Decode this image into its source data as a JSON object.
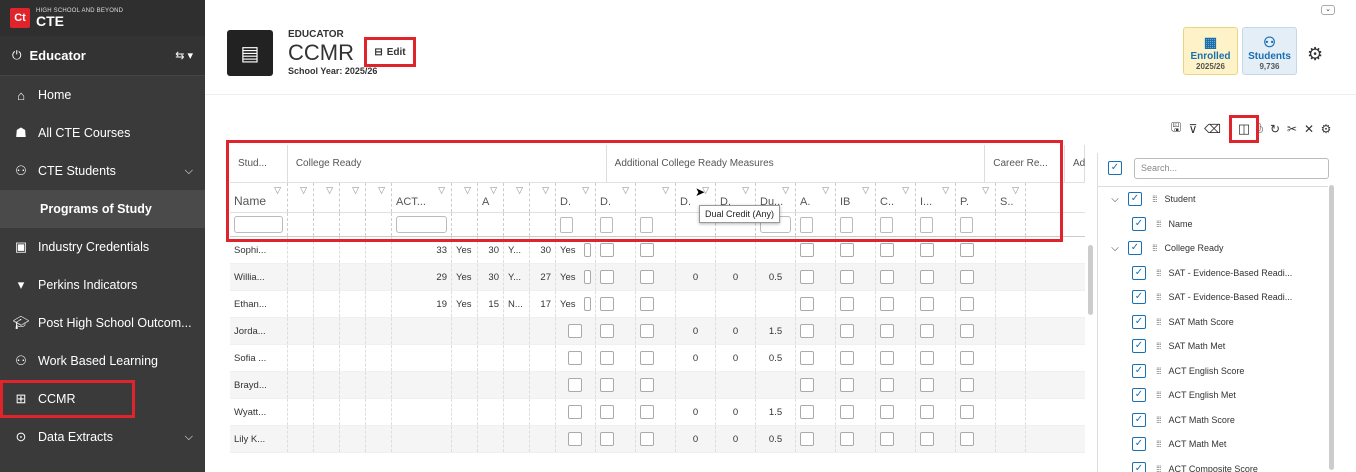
{
  "brand": {
    "small": "HIGH SCHOOL AND BEYOND",
    "name": "CTE",
    "logo": "Ct"
  },
  "role": {
    "label": "Educator"
  },
  "nav": [
    {
      "label": "Home",
      "icon": "home-icon"
    },
    {
      "label": "All CTE Courses",
      "icon": "courses-icon"
    },
    {
      "label": "CTE Students",
      "icon": "students-icon"
    },
    {
      "label": "Programs of Study",
      "icon": ""
    },
    {
      "label": "Industry Credentials",
      "icon": "credentials-icon"
    },
    {
      "label": "Perkins Indicators",
      "icon": "perkins-icon"
    },
    {
      "label": "Post High School Outcom...",
      "icon": "graduation-icon"
    },
    {
      "label": "Work Based Learning",
      "icon": "work-icon"
    },
    {
      "label": "CCMR",
      "icon": "table-icon"
    },
    {
      "label": "Data Extracts",
      "icon": "extract-icon"
    }
  ],
  "header": {
    "label": "EDUCATOR",
    "title": "CCMR",
    "edit": "Edit",
    "year": "School Year: 2025/26"
  },
  "cards": {
    "enrolled_label": "Enrolled",
    "enrolled_sub": "2025/26",
    "students_label": "Students",
    "students_count": "9,736"
  },
  "grid": {
    "groups": [
      "Stud...",
      "College Ready",
      "Additional College Ready Measures",
      "Career Re...",
      "Ad"
    ],
    "columns": [
      "Name",
      "",
      "",
      "",
      "",
      "ACT...",
      "",
      "A",
      "",
      "",
      "D.",
      "D.",
      "",
      "D.",
      "D.",
      "Du...",
      "A.",
      "IB",
      "C..",
      "I...",
      "P.",
      "S.."
    ],
    "rows": [
      [
        "Sophi...",
        "",
        "",
        "",
        "33",
        "Yes",
        "30",
        "Y...",
        "30",
        "Yes",
        "",
        "",
        "",
        "",
        "",
        ""
      ],
      [
        "Willia...",
        "",
        "",
        "",
        "29",
        "Yes",
        "30",
        "Y...",
        "27",
        "Yes",
        "",
        "",
        "",
        "0",
        "0",
        "0.5"
      ],
      [
        "Ethan...",
        "",
        "",
        "",
        "19",
        "Yes",
        "15",
        "N...",
        "17",
        "Yes",
        "",
        "",
        "",
        "",
        "",
        ""
      ],
      [
        "Jorda...",
        "",
        "",
        "",
        "",
        "",
        "",
        "",
        "",
        "",
        "",
        "",
        "",
        "0",
        "0",
        "1.5"
      ],
      [
        "Sofia ...",
        "",
        "",
        "",
        "",
        "",
        "",
        "",
        "",
        "",
        "",
        "",
        "",
        "0",
        "0",
        "0.5"
      ],
      [
        "Brayd...",
        "",
        "",
        "",
        "",
        "",
        "",
        "",
        "",
        "",
        "",
        "",
        "",
        "",
        "",
        ""
      ],
      [
        "Wyatt...",
        "",
        "",
        "",
        "",
        "",
        "",
        "",
        "",
        "",
        "",
        "",
        "",
        "0",
        "0",
        "1.5"
      ],
      [
        "Lily K...",
        "",
        "",
        "",
        "",
        "",
        "",
        "",
        "",
        "",
        "",
        "",
        "",
        "0",
        "0",
        "0.5"
      ]
    ],
    "tooltip": "Dual Credit (Any)"
  },
  "panel": {
    "search_placeholder": "Search...",
    "items": [
      {
        "label": "Student",
        "level": 0
      },
      {
        "label": "Name",
        "level": 1
      },
      {
        "label": "College Ready",
        "level": 0
      },
      {
        "label": "SAT - Evidence-Based Readi...",
        "level": 1
      },
      {
        "label": "SAT - Evidence-Based Readi...",
        "level": 1
      },
      {
        "label": "SAT Math Score",
        "level": 1
      },
      {
        "label": "SAT Math Met",
        "level": 1
      },
      {
        "label": "ACT English Score",
        "level": 1
      },
      {
        "label": "ACT English Met",
        "level": 1
      },
      {
        "label": "ACT Math Score",
        "level": 1
      },
      {
        "label": "ACT Math Met",
        "level": 1
      },
      {
        "label": "ACT Composite Score",
        "level": 1
      }
    ]
  },
  "colors": {
    "accent": "#e0242b",
    "sidebar": "#3a3a3a",
    "link": "#1a6fb0"
  }
}
